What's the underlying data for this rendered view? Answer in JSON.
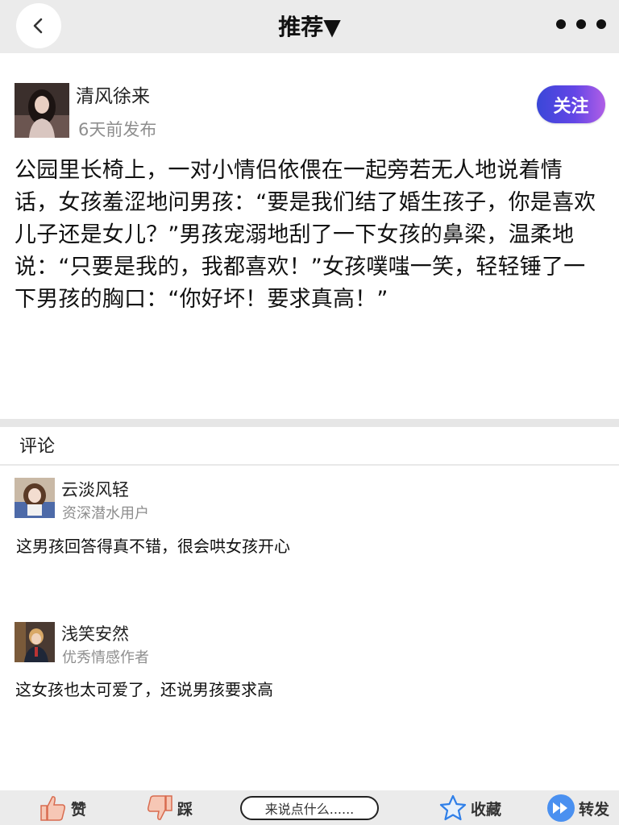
{
  "header": {
    "title": "推荐▼",
    "back_icon": "chevron-left-icon",
    "more_icon": "more-dots-icon"
  },
  "post": {
    "author": {
      "name": "清风徐来",
      "time": "6天前发布"
    },
    "follow_label": "关注",
    "content": "公园里长椅上，一对小情侣依偎在一起旁若无人地说着情话，女孩羞涩地问男孩：“要是我们结了婚生孩子，你是喜欢儿子还是女儿？”男孩宠溺地刮了一下女孩的鼻梁，温柔地说：“只要是我的，我都喜欢！”女孩噗嗤一笑，轻轻锤了一下男孩的胸口：“你好坏！要求真高！”"
  },
  "comments": {
    "header": "评论",
    "items": [
      {
        "name": "云淡风轻",
        "role": "资深潜水用户",
        "text": "这男孩回答得真不错，很会哄女孩开心"
      },
      {
        "name": "浅笑安然",
        "role": "优秀情感作者",
        "text": "这女孩也太可爱了，还说男孩要求高"
      }
    ]
  },
  "bottom_bar": {
    "like_label": "赞",
    "dislike_label": "踩",
    "input_placeholder": "来说点什么......",
    "favorite_label": "收藏",
    "share_label": "转发"
  },
  "colors": {
    "follow_gradient_start": "#3a47d8",
    "follow_gradient_end": "#b05ee6",
    "bar_background": "#ebebeb",
    "thumb_color": "#f08a6c",
    "star_color": "#2f7fe8",
    "share_color": "#4a90f0"
  }
}
